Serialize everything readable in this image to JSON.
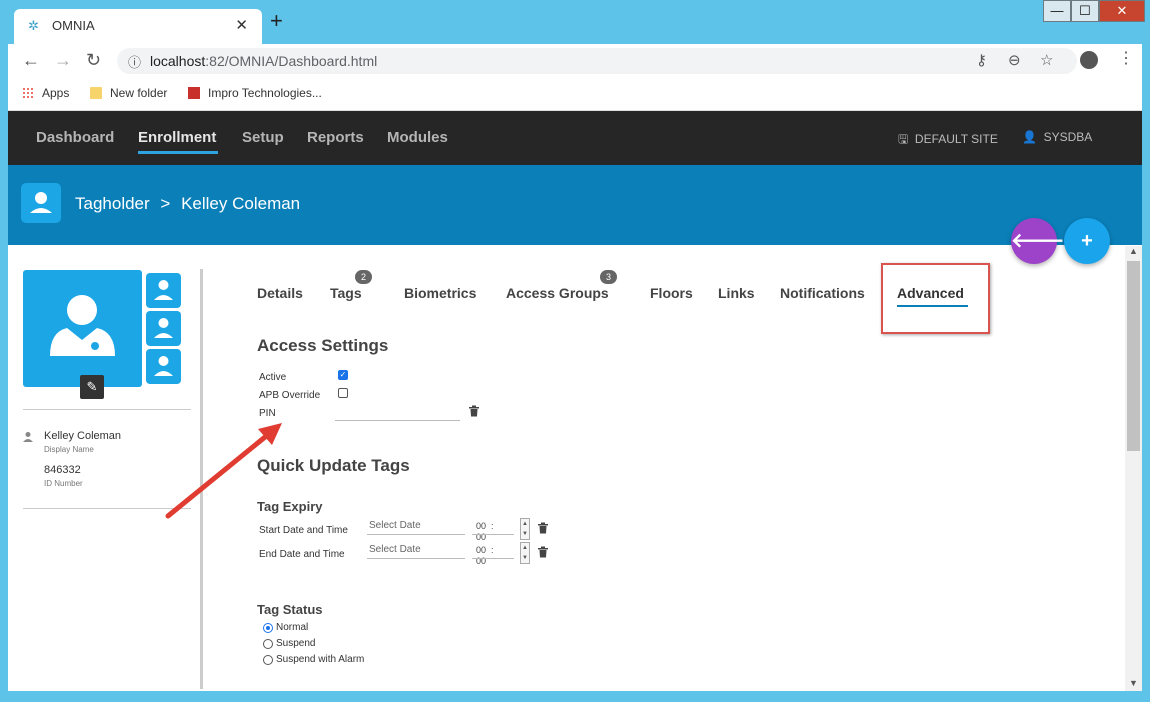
{
  "browser": {
    "tab_title": "OMNIA",
    "url_host": "localhost",
    "url_rest": ":82/OMNIA/Dashboard.html",
    "bookmarks": [
      "Apps",
      "New folder",
      "Impro Technologies..."
    ],
    "window_controls": {
      "minimize": "—",
      "maximize": "☐",
      "close": "✕"
    }
  },
  "nav": {
    "items": [
      "Dashboard",
      "Enrollment",
      "Setup",
      "Reports",
      "Modules"
    ],
    "active": "Enrollment",
    "site": "DEFAULT SITE",
    "user": "SYSDBA"
  },
  "header": {
    "section": "Tagholder",
    "separator": ">",
    "name": "Kelley Coleman"
  },
  "profile": {
    "display_name": "Kelley Coleman",
    "display_name_label": "Display Name",
    "id_number": "846332",
    "id_number_label": "ID Number"
  },
  "tabs": [
    {
      "label": "Details"
    },
    {
      "label": "Tags",
      "badge": "2"
    },
    {
      "label": "Biometrics"
    },
    {
      "label": "Access Groups",
      "badge": "3"
    },
    {
      "label": "Floors"
    },
    {
      "label": "Links"
    },
    {
      "label": "Notifications"
    },
    {
      "label": "Advanced",
      "active": true
    }
  ],
  "access_settings": {
    "title": "Access Settings",
    "active_label": "Active",
    "active_checked": true,
    "apb_label": "APB Override",
    "apb_checked": false,
    "pin_label": "PIN",
    "pin_value": ""
  },
  "quick_update": {
    "title": "Quick Update Tags",
    "expiry_title": "Tag Expiry",
    "start_label": "Start Date and Time",
    "end_label": "End Date and Time",
    "date_placeholder": "Select Date",
    "time_hours": "00",
    "time_sep": ":",
    "time_minutes": "00"
  },
  "tag_status": {
    "title": "Tag Status",
    "options": [
      "Normal",
      "Suspend",
      "Suspend with Alarm"
    ],
    "selected": "Normal"
  },
  "colors": {
    "nav_bg": "#262626",
    "header_bg": "#0a7fb8",
    "accent": "#1da6e6",
    "fab_back": "#9c43c9",
    "fab_add": "#1aa4ec",
    "annotation": "#d9534f"
  }
}
